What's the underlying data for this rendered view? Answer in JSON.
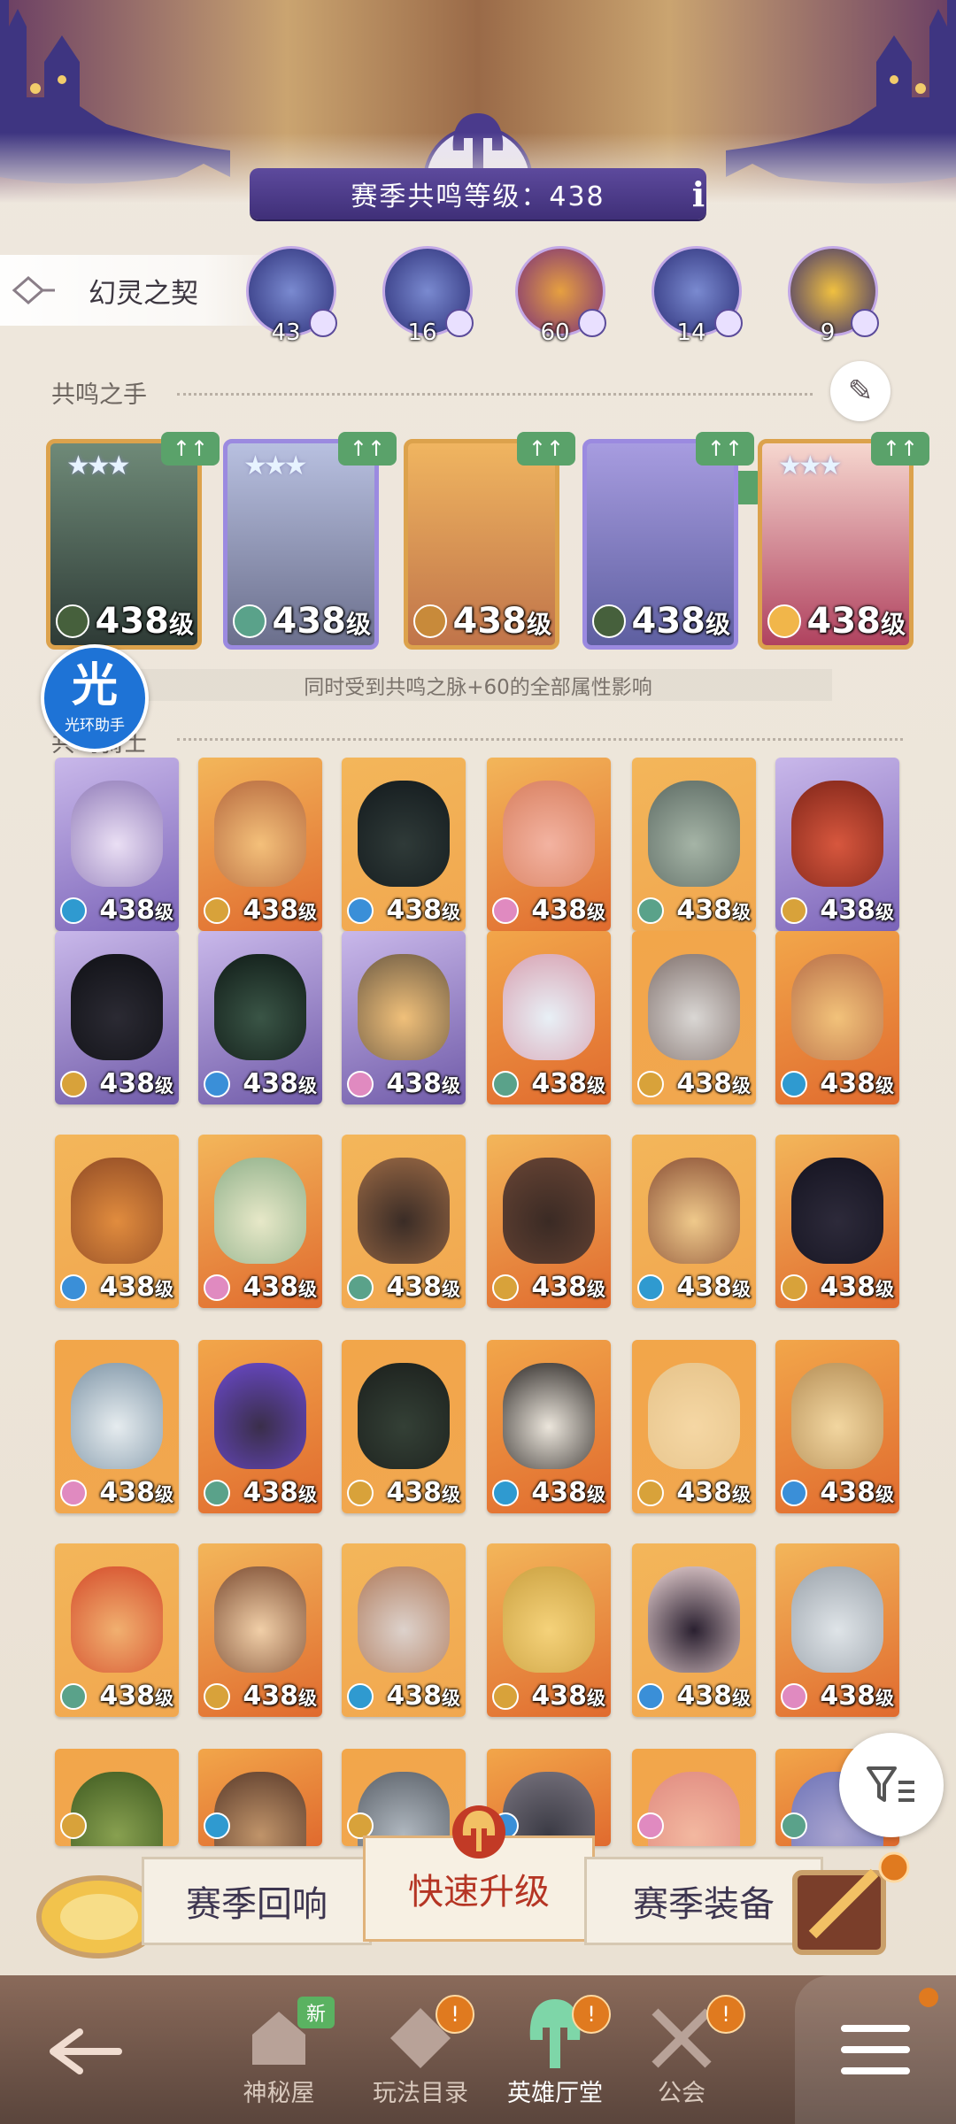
{
  "header": {
    "level_text": "赛季共鸣等级：438",
    "info_label": "i"
  },
  "contract": {
    "label": "幻灵之契",
    "slots": [
      {
        "level": "43",
        "upgrade": "↑"
      },
      {
        "level": "16",
        "upgrade": "↑"
      },
      {
        "level": "60",
        "upgrade": ""
      },
      {
        "level": "14",
        "upgrade": "↑"
      },
      {
        "level": "9",
        "upgrade": "↑"
      }
    ]
  },
  "resonance": {
    "title": "共鸣之手",
    "note": "同时受到共鸣之脉+60的全部属性影响",
    "cards": [
      {
        "level": "438",
        "suffix": "级",
        "upgrade": "↑↑"
      },
      {
        "level": "438",
        "suffix": "级",
        "upgrade": "↑↑"
      },
      {
        "level": "438",
        "suffix": "级",
        "upgrade": "↑↑"
      },
      {
        "level": "438",
        "suffix": "级",
        "upgrade": "↑↑"
      },
      {
        "level": "438",
        "suffix": "级",
        "upgrade": "↑↑"
      }
    ]
  },
  "assistant": {
    "glyph": "光",
    "label": "光环助手"
  },
  "knights": {
    "title": "共鸣骑士",
    "level": "438",
    "suffix": "级"
  },
  "menu": {
    "left": "赛季回响",
    "center": "快速升级",
    "right": "赛季装备"
  },
  "nav": {
    "items": [
      {
        "label": "神秘屋",
        "badge": "新"
      },
      {
        "label": "玩法目录",
        "badge": "!"
      },
      {
        "label": "英雄厅堂",
        "badge": "!"
      },
      {
        "label": "公会",
        "badge": "!"
      }
    ]
  },
  "colors": {
    "accent_purple": "#4a3a8c",
    "upgrade_green": "#5aa26a",
    "card_gold": "#dca24c",
    "level_red": "#b53524"
  }
}
